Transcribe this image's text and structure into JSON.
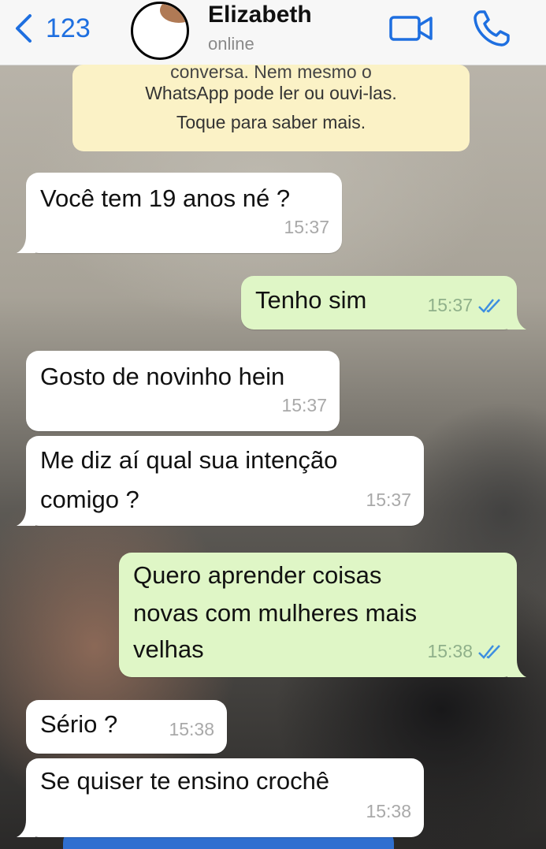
{
  "header": {
    "back_count": "123",
    "contact_name": "Elizabeth",
    "contact_status": "online",
    "icons": {
      "back": "chevron-left-icon",
      "video": "video-camera-icon",
      "call": "phone-icon"
    },
    "accent_color": "#1e6fe0"
  },
  "notice": {
    "line1": "conversa. Nem mesmo o",
    "line2": "WhatsApp pode ler ou ouvi-las.",
    "line3": "Toque para saber mais."
  },
  "messages": [
    {
      "direction": "in",
      "text": "Você tem 19 anos né ?",
      "time": "15:37"
    },
    {
      "direction": "out",
      "text": "Tenho sim",
      "time": "15:37",
      "status": "read"
    },
    {
      "direction": "in",
      "text": "Gosto de novinho hein",
      "time": "15:37"
    },
    {
      "direction": "in",
      "lines": [
        "Me diz aí qual sua intenção",
        "comigo ?"
      ],
      "time": "15:37"
    },
    {
      "direction": "out",
      "lines": [
        "Quero aprender coisas",
        "novas com mulheres mais",
        "velhas"
      ],
      "time": "15:38",
      "status": "read"
    },
    {
      "direction": "in",
      "text": "Sério ?",
      "time": "15:38"
    },
    {
      "direction": "in",
      "text": "Se quiser te ensino crochê",
      "time": "15:38"
    }
  ],
  "colors": {
    "incoming_bubble": "#ffffff",
    "outgoing_bubble": "#dff6c6",
    "notice_bg": "#fbf2c6",
    "read_ticks": "#3d8fe0"
  }
}
